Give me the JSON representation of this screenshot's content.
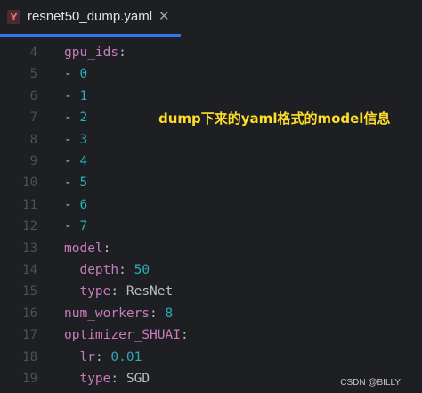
{
  "tab": {
    "icon_letter": "Y",
    "title": "resnet50_dump.yaml",
    "close_glyph": "✕"
  },
  "annotation": "dump下来的yaml格式的model信息",
  "watermark": "CSDN @BILLY",
  "colors": {
    "background": "#1e1f22",
    "tab_accent": "#3574f0",
    "key": "#c77dbb",
    "number": "#2aacb8",
    "text": "#bcbec4",
    "line_number": "#4b5059",
    "annotation": "#ffde2a"
  },
  "lines": [
    {
      "num": "4",
      "indent": "",
      "key": "gpu_ids",
      "sep": ":",
      "value": "",
      "value_type": ""
    },
    {
      "num": "5",
      "indent": "",
      "key": "",
      "sep": "- ",
      "value": "0",
      "value_type": "n"
    },
    {
      "num": "6",
      "indent": "",
      "key": "",
      "sep": "- ",
      "value": "1",
      "value_type": "n"
    },
    {
      "num": "7",
      "indent": "",
      "key": "",
      "sep": "- ",
      "value": "2",
      "value_type": "n"
    },
    {
      "num": "8",
      "indent": "",
      "key": "",
      "sep": "- ",
      "value": "3",
      "value_type": "n"
    },
    {
      "num": "9",
      "indent": "",
      "key": "",
      "sep": "- ",
      "value": "4",
      "value_type": "n"
    },
    {
      "num": "10",
      "indent": "",
      "key": "",
      "sep": "- ",
      "value": "5",
      "value_type": "n"
    },
    {
      "num": "11",
      "indent": "",
      "key": "",
      "sep": "- ",
      "value": "6",
      "value_type": "n"
    },
    {
      "num": "12",
      "indent": "",
      "key": "",
      "sep": "- ",
      "value": "7",
      "value_type": "n"
    },
    {
      "num": "13",
      "indent": "",
      "key": "model",
      "sep": ":",
      "value": "",
      "value_type": ""
    },
    {
      "num": "14",
      "indent": "  ",
      "key": "depth",
      "sep": ": ",
      "value": "50",
      "value_type": "n"
    },
    {
      "num": "15",
      "indent": "  ",
      "key": "type",
      "sep": ": ",
      "value": "ResNet",
      "value_type": "s"
    },
    {
      "num": "16",
      "indent": "",
      "key": "num_workers",
      "sep": ": ",
      "value": "8",
      "value_type": "n"
    },
    {
      "num": "17",
      "indent": "",
      "key": "optimizer_SHUAI",
      "sep": ":",
      "value": "",
      "value_type": ""
    },
    {
      "num": "18",
      "indent": "  ",
      "key": "lr",
      "sep": ": ",
      "value": "0.01",
      "value_type": "n"
    },
    {
      "num": "19",
      "indent": "  ",
      "key": "type",
      "sep": ": ",
      "value": "SGD",
      "value_type": "s"
    }
  ]
}
